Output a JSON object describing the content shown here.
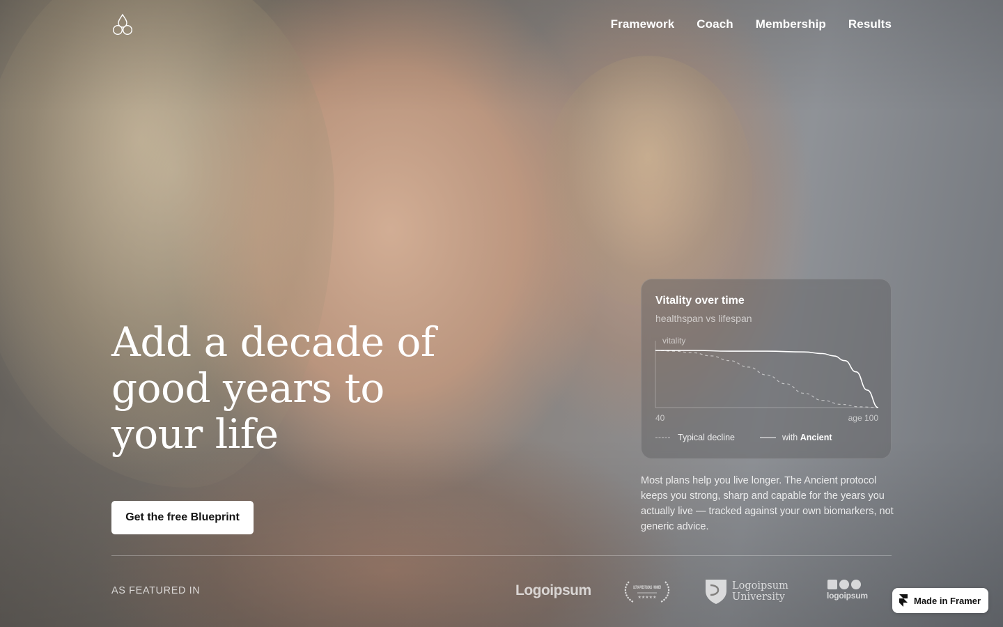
{
  "header": {
    "logo_icon": "trefoil-drops-icon",
    "nav": [
      {
        "label": "Framework"
      },
      {
        "label": "Coach"
      },
      {
        "label": "Membership"
      },
      {
        "label": "Results"
      }
    ]
  },
  "hero": {
    "headline": "Add a decade of good years to your life",
    "cta_label": "Get the free Blueprint"
  },
  "vitality_card": {
    "title": "Vitality over time",
    "subtitle": "healthspan vs lifespan",
    "y_label": "vitality",
    "x_start": "40",
    "x_end": "age 100",
    "legend": {
      "typical": "Typical decline",
      "with_prefix": "with",
      "with_brand": "Ancient"
    }
  },
  "chart_data": {
    "type": "line",
    "title": "Vitality over time",
    "subtitle": "healthspan vs lifespan",
    "ylabel": "vitality",
    "x_tick_labels": [
      "40",
      "age 100"
    ],
    "xlim": [
      40,
      100
    ],
    "ylim": [
      0,
      1
    ],
    "grid": false,
    "series": [
      {
        "name": "Typical decline",
        "style": "dashed",
        "x": [
          40,
          45,
          50,
          55,
          60,
          65,
          70,
          75,
          80,
          85,
          90,
          95,
          100
        ],
        "y": [
          0.72,
          0.71,
          0.69,
          0.65,
          0.59,
          0.51,
          0.41,
          0.3,
          0.18,
          0.09,
          0.04,
          0.01,
          0.0
        ]
      },
      {
        "name": "with Ancient",
        "style": "solid",
        "x": [
          40,
          50,
          60,
          70,
          80,
          85,
          88,
          91,
          94,
          97,
          100
        ],
        "y": [
          0.72,
          0.72,
          0.71,
          0.71,
          0.7,
          0.68,
          0.65,
          0.59,
          0.45,
          0.22,
          0.0
        ]
      }
    ]
  },
  "description": "Most plans help you live longer. The Ancient protocol keeps you strong, sharp and capable for the years you actually live — tracked against your own biomarkers, not generic advice.",
  "featured": {
    "label": "AS FEATURED IN",
    "logos": [
      {
        "text": "Logoipsum"
      },
      {
        "text": "ULTRA PRESTIGIOUS · WINNER"
      },
      {
        "line1": "Logoipsum",
        "line2": "University"
      },
      {
        "text": "logoipsum"
      }
    ]
  },
  "framer_badge": {
    "label": "Made in Framer",
    "icon": "framer-icon"
  }
}
